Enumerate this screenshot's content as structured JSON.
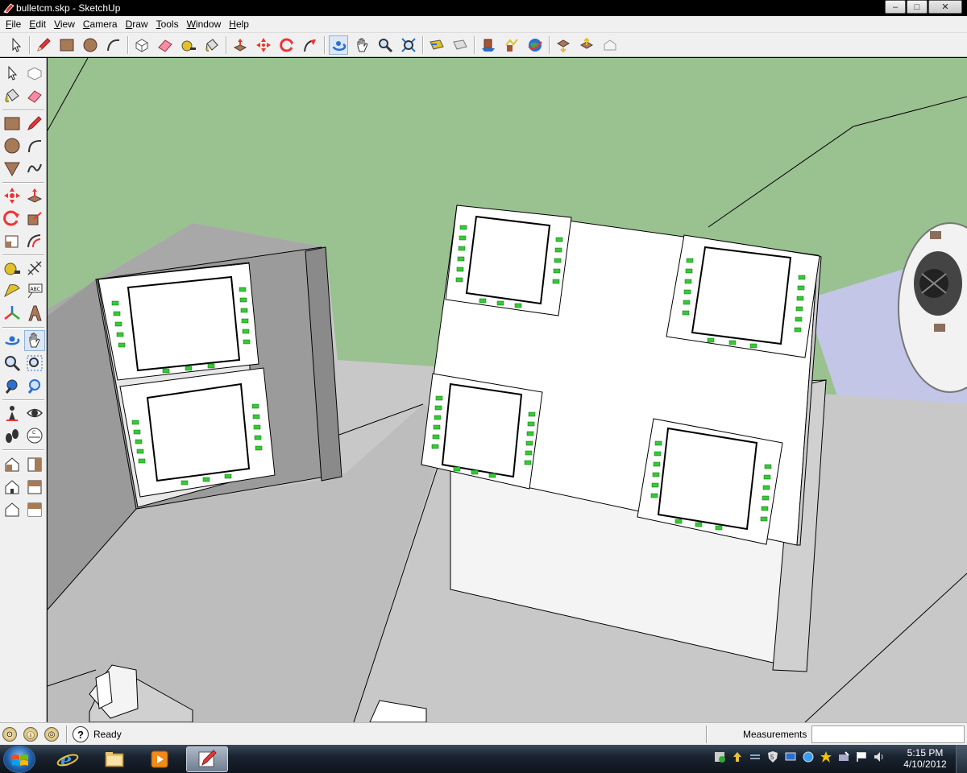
{
  "window": {
    "title": "bulletcm.skp - SketchUp",
    "app_icon": "sketchup-logo-icon",
    "controls": {
      "minimize": "–",
      "maximize": "□",
      "close": "✕"
    }
  },
  "menu": [
    {
      "label": "File",
      "accel": "F",
      "rest": "ile"
    },
    {
      "label": "Edit",
      "accel": "E",
      "rest": "dit"
    },
    {
      "label": "View",
      "accel": "V",
      "rest": "iew"
    },
    {
      "label": "Camera",
      "accel": "C",
      "rest": "amera"
    },
    {
      "label": "Draw",
      "accel": "D",
      "rest": "raw"
    },
    {
      "label": "Tools",
      "accel": "T",
      "rest": "ools"
    },
    {
      "label": "Window",
      "accel": "W",
      "rest": "indow"
    },
    {
      "label": "Help",
      "accel": "H",
      "rest": "elp"
    }
  ],
  "toolbar": {
    "tools": [
      "select-icon",
      "pencil-icon",
      "rectangle-icon",
      "circle-icon",
      "arc-icon",
      "make-component-icon",
      "eraser-icon",
      "tape-measure-icon",
      "paint-bucket-icon",
      "push-pull-icon",
      "move-icon",
      "rotate-icon",
      "follow-me-icon",
      "orbit-icon",
      "pan-icon",
      "zoom-icon",
      "zoom-extents-icon",
      "previous-view-icon",
      "next-view-icon",
      "get-models-icon",
      "share-model-icon",
      "google-earth-icon",
      "get-models-3d-icon",
      "share-component-icon",
      "add-location-icon"
    ]
  },
  "left_toolbar": {
    "tools": [
      "select-icon",
      "make-component-icon",
      "paint-bucket-icon",
      "eraser-icon",
      "rectangle-icon",
      "line-icon",
      "circle-icon",
      "arc-icon",
      "polygon-icon",
      "freehand-icon",
      "move-icon",
      "push-pull-icon",
      "rotate-icon",
      "follow-me-icon",
      "scale-icon",
      "offset-icon",
      "tape-measure-icon",
      "dimension-icon",
      "protractor-icon",
      "text-icon",
      "axes-icon",
      "3d-text-icon",
      "orbit-icon",
      "pan-icon",
      "zoom-icon",
      "zoom-window-icon",
      "zoom-extents-icon",
      "previous-icon",
      "position-camera-icon",
      "look-around-icon",
      "walk-icon",
      "section-plane-icon",
      "iso-view-icon",
      "front-view-icon",
      "top-view-icon",
      "right-view-icon",
      "back-view-icon",
      "left-view-icon"
    ],
    "text_tool_label": "ABC"
  },
  "colors": {
    "sky": "#9ac190",
    "ground": "#c8c8c8",
    "ground_dark": "#a8a8a8",
    "wall_lavender": "#c3c6e6",
    "panel_white": "#ffffff",
    "button_green": "#33cc33",
    "edge": "#000000"
  },
  "status": {
    "help_glyph": "?",
    "text": "Ready",
    "measurements_label": "Measurements",
    "measurements_value": ""
  },
  "taskbar": {
    "items": [
      {
        "name": "internet-explorer-icon",
        "active": false
      },
      {
        "name": "windows-explorer-icon",
        "active": false
      },
      {
        "name": "media-player-icon",
        "active": false
      },
      {
        "name": "sketchup-icon",
        "active": true
      }
    ],
    "tray_icons": [
      "security-icon",
      "update-icon",
      "network-transfer-icon",
      "shield-5-icon",
      "display-icon",
      "network-icon",
      "star-icon",
      "pen-tablet-icon",
      "action-center-icon",
      "volume-icon"
    ],
    "time": "5:15 PM",
    "date": "4/10/2012"
  }
}
